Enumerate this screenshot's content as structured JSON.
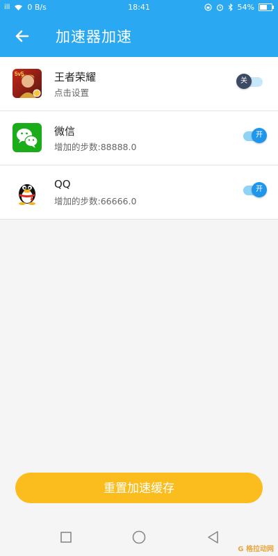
{
  "status_bar": {
    "signal_text": "ill",
    "network_speed": "0 B/s",
    "time": "18:41",
    "battery": "54%"
  },
  "app_bar": {
    "back_icon": "arrow-left-icon",
    "title": "加速器加速"
  },
  "apps": [
    {
      "name": "王者荣耀",
      "subtitle": "点击设置",
      "toggle_state": "off",
      "toggle_label": "关",
      "icon": "honor-of-kings-icon"
    },
    {
      "name": "微信",
      "subtitle": "增加的步数:88888.0",
      "toggle_state": "on",
      "toggle_label": "开",
      "icon": "wechat-icon"
    },
    {
      "name": "QQ",
      "subtitle": "增加的步数:66666.0",
      "toggle_state": "on",
      "toggle_label": "开",
      "icon": "qq-penguin-icon"
    }
  ],
  "reset_button": {
    "label": "重置加速缓存"
  },
  "nav_bar": {
    "recent": "square-icon",
    "home": "circle-icon",
    "back": "triangle-back-icon"
  },
  "watermark": {
    "text": "G 格拉动网"
  },
  "colors": {
    "primary": "#2aa8f2",
    "accent_button": "#fbbd1d",
    "toggle_on": "#1f96ec",
    "toggle_off": "#3d4a63"
  }
}
